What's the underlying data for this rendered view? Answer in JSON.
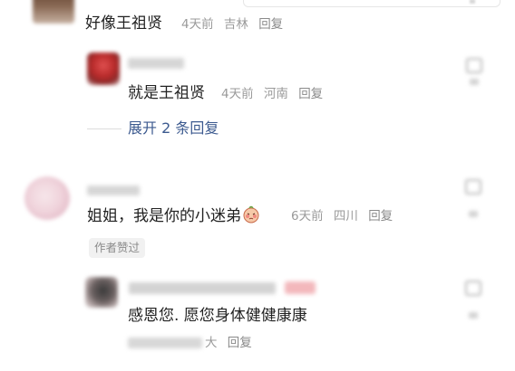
{
  "comments": [
    {
      "text": "好像王祖贤",
      "time": "4天前",
      "location": "吉林",
      "reply_label": "回复"
    },
    {
      "text": "就是王祖贤",
      "time": "4天前",
      "location": "河南",
      "reply_label": "回复"
    },
    {
      "text_before_emoji": "姐姐，我是你的小迷弟",
      "emoji": "shy-blush-emoji",
      "time": "6天前",
      "location": "四川",
      "reply_label": "回复",
      "badge": "作者赞过"
    },
    {
      "text": "感恩您. 愿您身体健健康康",
      "location_suffix": "大",
      "reply_label": "回复"
    }
  ],
  "expand_label": "展开 2 条回复",
  "colors": {
    "link_blue": "#3c5a8f",
    "meta_gray": "#9a9a9a",
    "text": "#222222",
    "badge_bg": "#f1f1f1"
  }
}
